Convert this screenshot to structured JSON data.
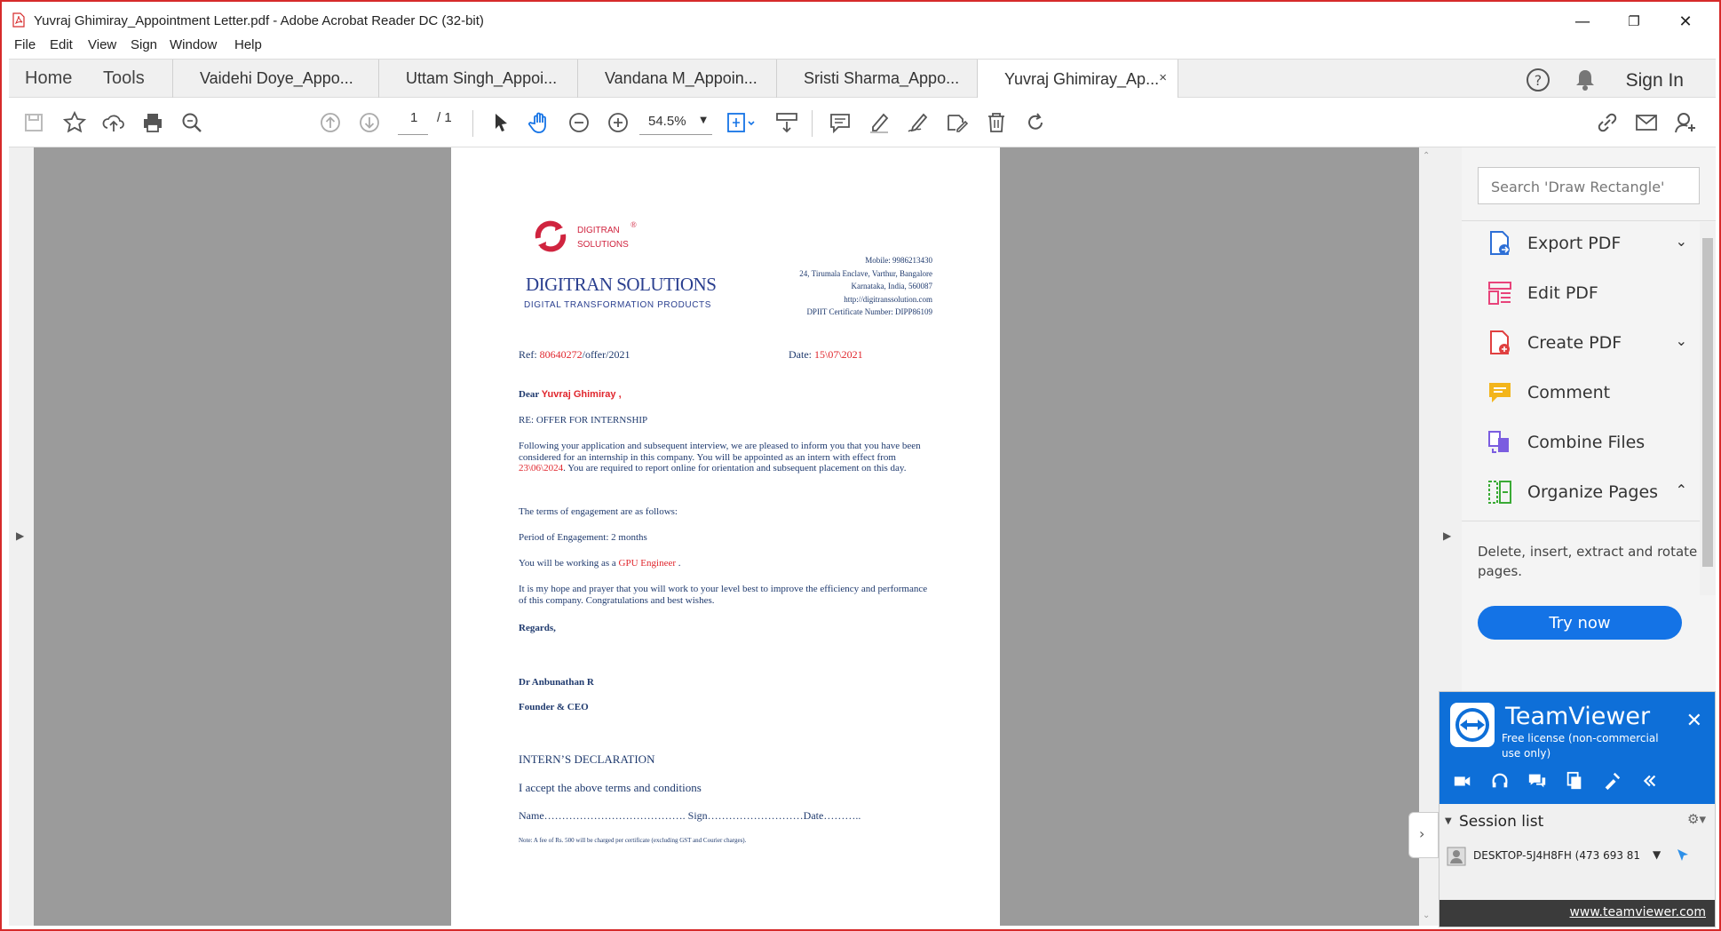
{
  "window": {
    "title": "Yuvraj Ghimiray_Appointment Letter.pdf - Adobe Acrobat Reader DC (32-bit)",
    "minimize": "—",
    "restore": "❐",
    "close": "✕"
  },
  "menu": [
    "File",
    "Edit",
    "View",
    "Sign",
    "Window",
    "Help"
  ],
  "tabs": {
    "home": "Home",
    "tools": "Tools",
    "documents": [
      "Vaidehi Doye_Appo...",
      "Uttam Singh_Appoi...",
      "Vandana M_Appoin...",
      "Sristi Sharma_Appo...",
      "Yuvraj Ghimiray_Ap..."
    ],
    "close_glyph": "×",
    "sign_in": "Sign In"
  },
  "toolbar": {
    "page_current": "1",
    "page_total": "/ 1",
    "zoom": "54.5%",
    "icons": [
      "save-icon",
      "star-icon",
      "upload-icon",
      "print-icon",
      "search-icon",
      "page-up-icon",
      "page-down-icon",
      "select-cursor-icon",
      "hand-icon",
      "zoom-out-icon",
      "zoom-in-icon",
      "fit-page-icon",
      "scroll-mode-icon",
      "comment-icon",
      "highlight-icon",
      "sign-icon",
      "edit-icon",
      "delete-icon",
      "rotate-icon",
      "share-link-icon",
      "email-icon",
      "add-user-icon"
    ]
  },
  "letter": {
    "logo_brand": "DIGITRAN SOLUTIONS",
    "logo_tagline": "DIGITAL TRANSFORMATION PRODUCTS",
    "logo_small": "DIGITRAN SOLUTIONS",
    "contact": [
      "Mobile: 9986213430",
      "24, Tirumala Enclave, Varthur, Bangalore",
      "Karnataka, India, 560087",
      "http://digitranssolution.com",
      "DPIIT Certificate Number: DIPP86109"
    ],
    "ref_label": "Ref: ",
    "ref_number": "80640272",
    "ref_suffix": "/offer/2021",
    "date_label": "Date: ",
    "date_value": "15\\07\\2021",
    "dear": "Dear ",
    "name": "Yuvraj Ghimiray ,",
    "re_line": "RE: OFFER FOR INTERNSHIP",
    "para1_a": "Following your application and subsequent interview, we are pleased to inform you that you have been considered for an internship in this company. You will be appointed as an intern with effect from ",
    "para1_date": "23\\06\\2024",
    "para1_b": ". You are required to report online for orientation and subsequent placement on this day.",
    "terms": "The terms of engagement are as follows:",
    "period": "Period of Engagement: 2 months",
    "role_a": "You will be working as a ",
    "role": "GPU Engineer",
    "role_b": " .",
    "para2": "It is my hope and prayer that you will work to your level best to improve the efficiency and performance of this company. Congratulations and best wishes.",
    "regards": "Regards,",
    "signatory": "Dr Anbunathan R",
    "designation": "Founder & CEO",
    "declaration_title": "INTERN’S DECLARATION",
    "declaration_text": "I accept the above terms and conditions",
    "declaration_fields": "Name…………………………………. Sign………………………Date………..",
    "note": "Note: A fee of Rs. 500 will be charged per certificate (excluding GST and Courier charges)."
  },
  "panel": {
    "search_placeholder": "Search 'Draw Rectangle'",
    "tools": [
      {
        "label": "Export PDF",
        "chevron": "⌄",
        "color": "#2d6fd6"
      },
      {
        "label": "Edit PDF",
        "chevron": "",
        "color": "#e8437a"
      },
      {
        "label": "Create PDF",
        "chevron": "⌄",
        "color": "#e04040"
      },
      {
        "label": "Comment",
        "chevron": "",
        "color": "#f3b51b"
      },
      {
        "label": "Combine Files",
        "chevron": "",
        "color": "#7b5de0"
      },
      {
        "label": "Organize Pages",
        "chevron": "⌃",
        "color": "#3aaa35"
      }
    ],
    "organize_desc": "Delete, insert, extract and rotate pages.",
    "try_now": "Try now"
  },
  "teamviewer": {
    "name": "TeamViewer",
    "license": "Free license (non-commercial use only)",
    "close": "✕",
    "session_list": "Session list",
    "session_item": "DESKTOP-5J4H8FH (473 693 81",
    "website": "www.teamviewer.com"
  }
}
